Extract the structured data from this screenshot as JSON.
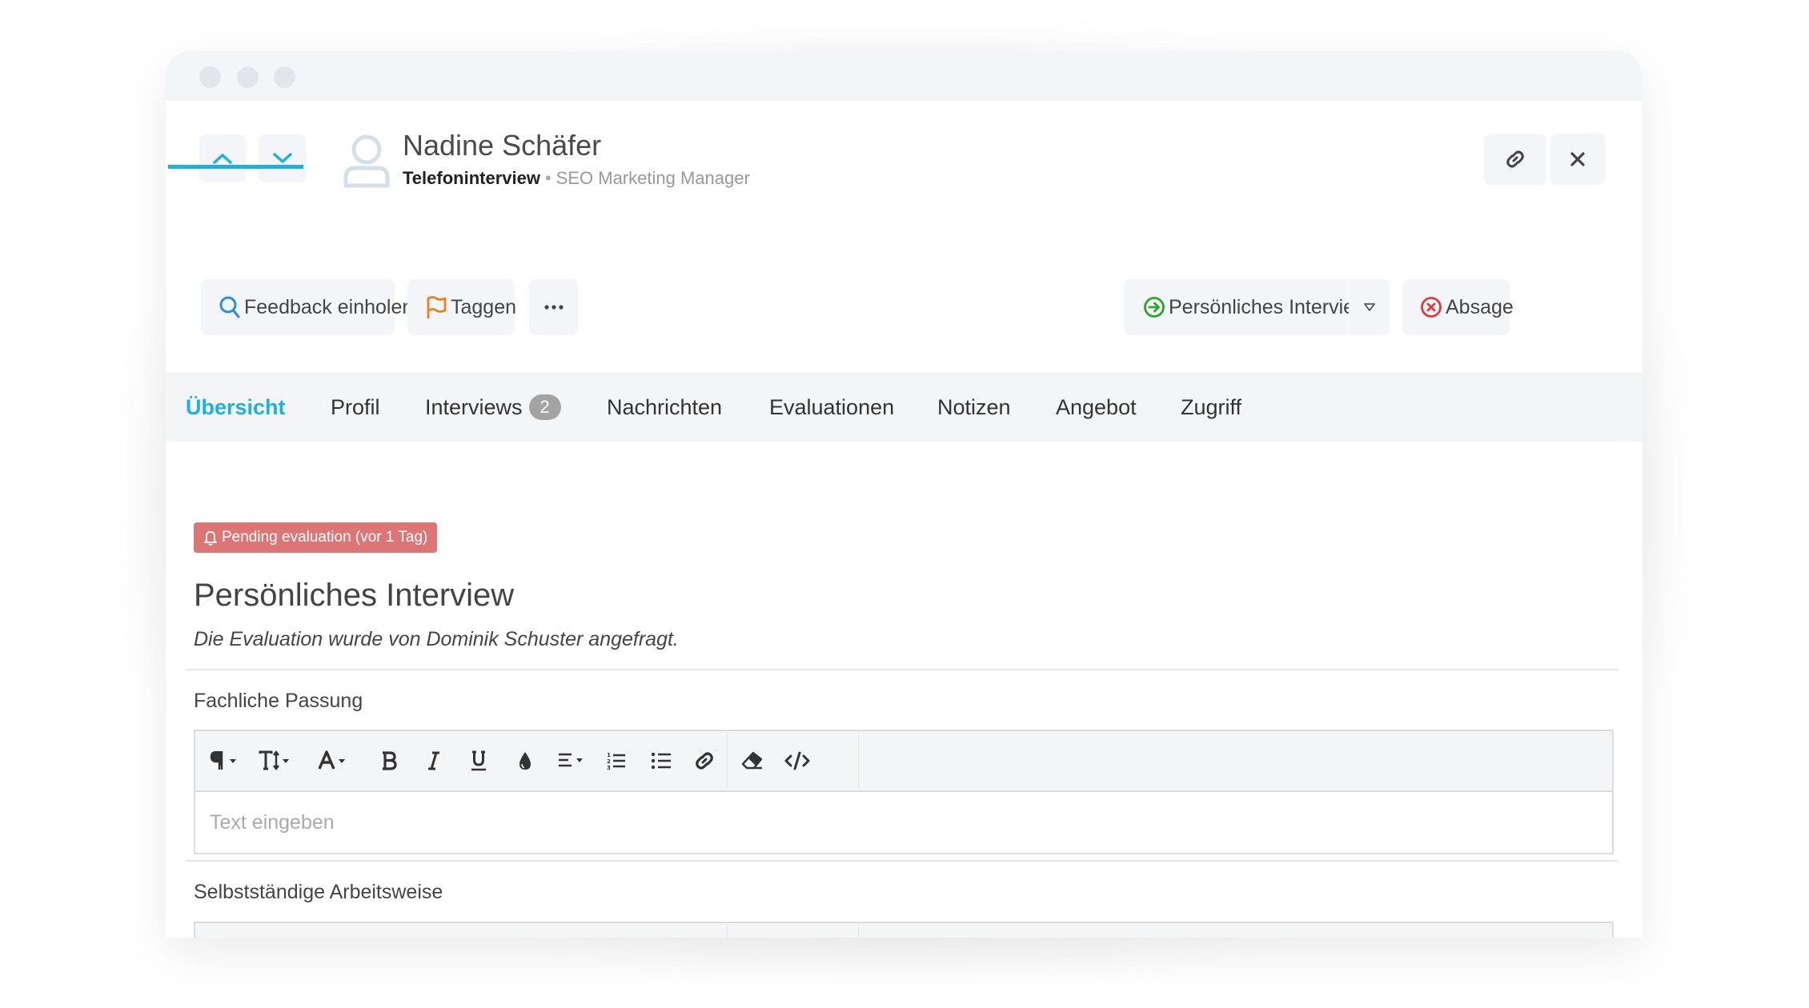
{
  "window": {
    "controls": [
      "close",
      "minimize",
      "maximize"
    ]
  },
  "header": {
    "nav_up_icon": "chevron-up-icon",
    "nav_down_icon": "chevron-down-icon",
    "avatar_icon": "user-icon",
    "candidate_name": "Nadine Schäfer",
    "stage": "Telefoninterview",
    "separator": "•",
    "job_title": "SEO Marketing Manager",
    "copy_link_icon": "link-icon",
    "close_icon": "close-icon"
  },
  "actions": {
    "feedback": {
      "label": "Feedback einholen",
      "icon": "search-icon"
    },
    "tag": {
      "label": "Taggen",
      "icon": "flag-icon"
    },
    "more": {
      "label": "···",
      "icon": "more-icon"
    },
    "next_stage": {
      "label": "Persönliches Interview",
      "icon": "arrow-circle-right-icon"
    },
    "next_stage_dropdown_icon": "triangle-down-icon",
    "reject": {
      "label": "Absage",
      "icon": "x-circle-icon"
    }
  },
  "colors": {
    "accent": "#1fb0db",
    "pending": "#dc7676",
    "advance": "#2aa52a",
    "reject": "#e0383e",
    "tag": "#e8821e",
    "feedback": "#2a8fd6"
  },
  "tabs": [
    {
      "label": "Übersicht",
      "active": true
    },
    {
      "label": "Profil"
    },
    {
      "label": "Interviews",
      "count": "2"
    },
    {
      "label": "Nachrichten"
    },
    {
      "label": "Evaluationen"
    },
    {
      "label": "Notizen"
    },
    {
      "label": "Angebot"
    },
    {
      "label": "Zugriff"
    }
  ],
  "evaluation": {
    "status_badge": "Pending evaluation (vor 1 Tag)",
    "title": "Persönliches Interview",
    "subtitle": "Die Evaluation wurde von Dominik Schuster angefragt.",
    "fields": [
      {
        "label": "Fachliche Passung",
        "placeholder": "Text eingeben"
      },
      {
        "label": "Selbstständige Arbeitsweise",
        "placeholder": ""
      }
    ]
  },
  "editor_toolbar": [
    {
      "name": "paragraph-style",
      "icon": "paragraph-icon",
      "dropdown": true
    },
    {
      "name": "font-size",
      "icon": "text-height-icon",
      "dropdown": true
    },
    {
      "name": "font-color",
      "icon": "font-icon",
      "dropdown": true
    },
    {
      "name": "bold",
      "icon": "bold-icon"
    },
    {
      "name": "italic",
      "icon": "italic-icon"
    },
    {
      "name": "underline",
      "icon": "underline-icon"
    },
    {
      "name": "highlight",
      "icon": "tint-icon"
    },
    {
      "name": "align",
      "icon": "align-left-icon",
      "dropdown": true
    },
    {
      "name": "ordered-list",
      "icon": "list-ol-icon"
    },
    {
      "name": "unordered-list",
      "icon": "list-ul-icon"
    },
    {
      "name": "insert-link",
      "icon": "link-icon"
    },
    {
      "name": "clear-format",
      "icon": "eraser-icon"
    },
    {
      "name": "code-view",
      "icon": "code-icon"
    }
  ]
}
